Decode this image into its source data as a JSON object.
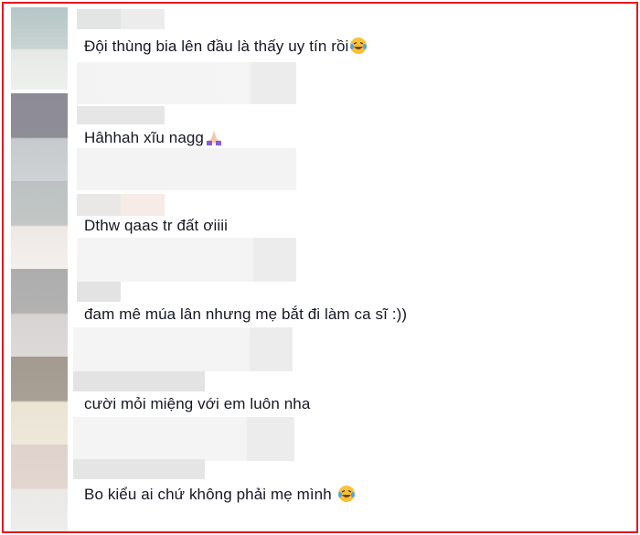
{
  "colors": {
    "border": "#e8171c",
    "text": "#161823"
  },
  "comments": [
    {
      "text": "Đội thùng bia lên đầu là thấy uy tín rồi",
      "emoji": "laughing-tears-emoji"
    },
    {
      "text": "Hâhhah xĩu nagg",
      "emoji": "praying-hands-emoji"
    },
    {
      "text": "Dthw qaas tr đất ơiiii"
    },
    {
      "text": "đam mê múa lân nhưng mẹ bắt đi làm ca sĩ :))"
    },
    {
      "text": "cười mỏi miệng với em luôn nha"
    },
    {
      "text": "Bo kiểu ai chứ không phải mẹ mình ",
      "emoji": "laughing-tears-emoji"
    }
  ]
}
